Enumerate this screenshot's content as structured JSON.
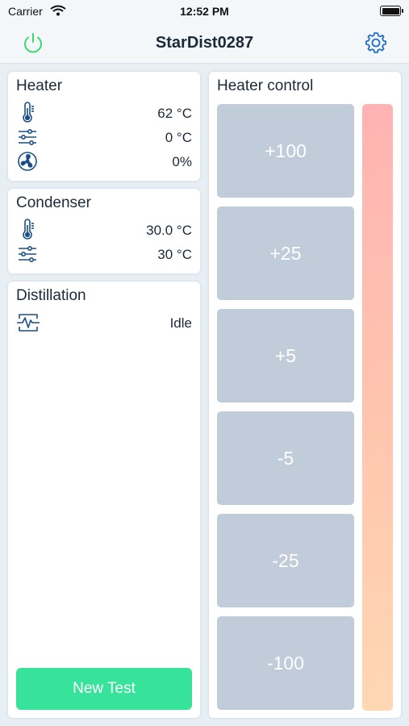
{
  "status_bar": {
    "carrier": "Carrier",
    "time": "12:52 PM"
  },
  "nav": {
    "title": "StarDist0287",
    "power_icon": "power-icon",
    "settings_icon": "gear-icon",
    "power_color": "#3ad96b",
    "accent": "#1f6fc7"
  },
  "heater": {
    "title": "Heater",
    "temperature": "62 °C",
    "setpoint": "0 °C",
    "fan": "0%"
  },
  "condenser": {
    "title": "Condenser",
    "temperature": "30.0 °C",
    "setpoint": "30 °C"
  },
  "distillation": {
    "title": "Distillation",
    "status": "Idle",
    "new_test_label": "New Test",
    "new_test_color": "#37e39a"
  },
  "heater_control": {
    "title": "Heater control",
    "buttons": [
      "+100",
      "+25",
      "+5",
      "-5",
      "-25",
      "-100"
    ],
    "button_color": "#c0ccd9"
  }
}
